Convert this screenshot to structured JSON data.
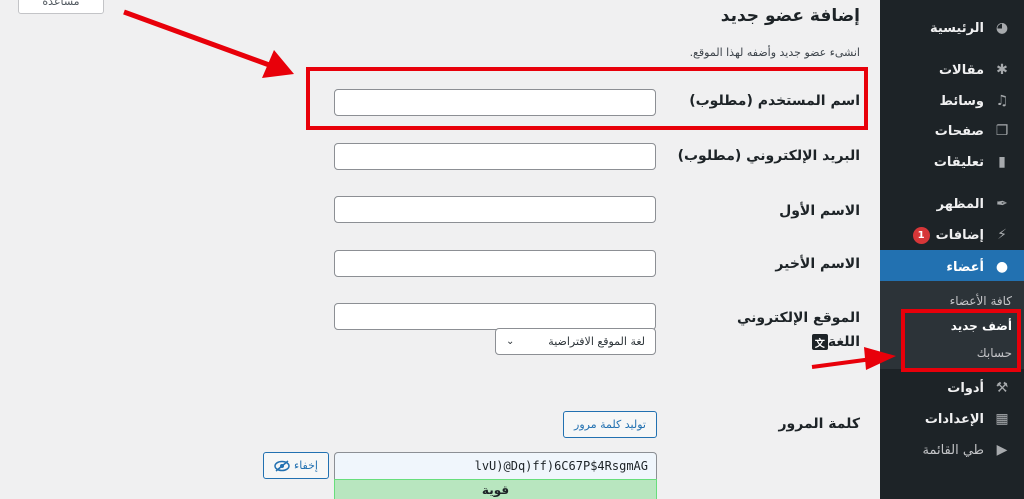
{
  "page": {
    "title": "إضافة عضو جديد",
    "description": "انشىء عضو جديد وأضفه لهذا الموقع.",
    "help_button": "مساعدة"
  },
  "form": {
    "username_label": "اسم المستخدم (مطلوب)",
    "email_label": "البريد الإلكتروني (مطلوب)",
    "first_name_label": "الاسم الأول",
    "last_name_label": "الاسم الأخير",
    "website_label": "الموقع الإلكتروني",
    "language_label": "اللغة",
    "language_value": "لغة الموقع الافتراضية",
    "password_label": "كلمة المرور",
    "generate_password": "توليد كلمة مرور",
    "password_value": "lvU)@Dq)ff)6C67P$4RsgmAG",
    "password_strength": "قوية",
    "hide_button": "إخفاء"
  },
  "sidebar": {
    "items": [
      {
        "label": "الرئيسية",
        "icon": "dashboard-icon"
      },
      {
        "label": "مقالات",
        "icon": "pin-icon"
      },
      {
        "label": "وسائط",
        "icon": "media-icon"
      },
      {
        "label": "صفحات",
        "icon": "pages-icon"
      },
      {
        "label": "تعليقات",
        "icon": "comment-icon"
      },
      {
        "label": "المظهر",
        "icon": "brush-icon"
      },
      {
        "label": "إضافات",
        "icon": "plugin-icon",
        "badge": "1"
      },
      {
        "label": "أعضاء",
        "icon": "user-icon"
      },
      {
        "label": "أدوات",
        "icon": "wrench-icon"
      },
      {
        "label": "الإعدادات",
        "icon": "settings-icon"
      },
      {
        "label": "طي القائمة",
        "icon": "collapse-icon"
      }
    ],
    "submenu": [
      "كافة الأعضاء",
      "أضف جديد",
      "حسابك"
    ]
  },
  "colors": {
    "sidebar_bg": "#1d2327",
    "accent": "#2271b1",
    "annotation": "#e8000a"
  }
}
